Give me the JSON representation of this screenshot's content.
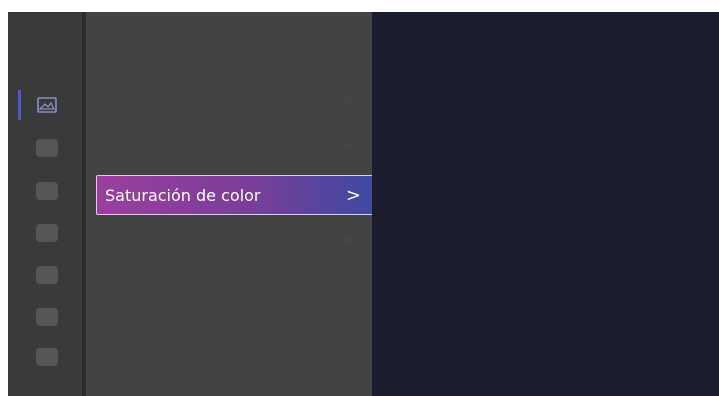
{
  "colors": {
    "right_panel": "#1a1d2e",
    "menu_panel": "#434343",
    "rail": "#3a3a3a",
    "selected_gradient_start": "#9b3f9e",
    "selected_gradient_end": "#3d4aa1",
    "accent": "#4a5ad0"
  },
  "rail": {
    "icons": [
      {
        "name": "picture-icon",
        "state": "selected"
      },
      {
        "name": "sound-icon",
        "state": "dim"
      },
      {
        "name": "network-icon",
        "state": "dim"
      },
      {
        "name": "display-icon",
        "state": "dim"
      },
      {
        "name": "system-icon",
        "state": "dim"
      },
      {
        "name": "support-icon",
        "state": "dim"
      },
      {
        "name": "more-icon",
        "state": "dim"
      }
    ]
  },
  "menu": {
    "title": "",
    "items": [
      {
        "label": "",
        "chevron": ">"
      },
      {
        "label": "",
        "chevron": ">"
      },
      {
        "label": "Saturación de color",
        "chevron": ">",
        "selected": true
      },
      {
        "label": "",
        "chevron": ">"
      }
    ]
  }
}
